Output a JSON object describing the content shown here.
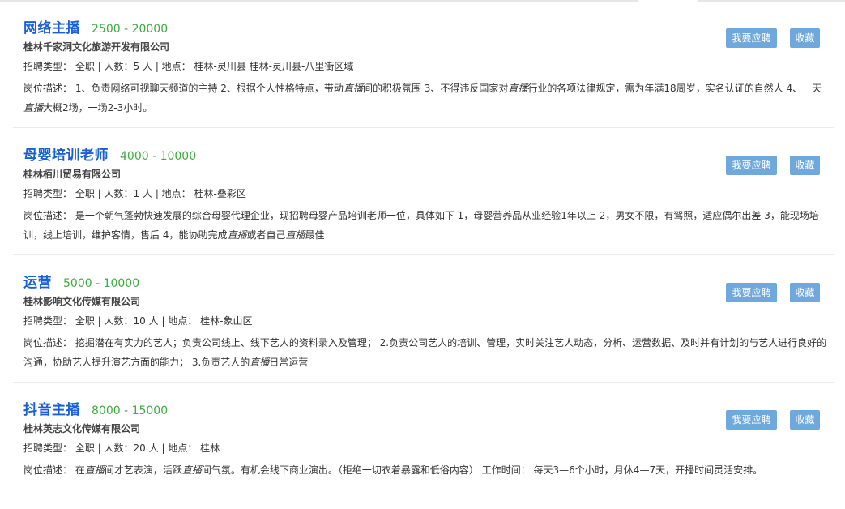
{
  "labels": {
    "type": "招聘类型：",
    "desc": "岗位描述：",
    "people": "人数：",
    "location": "地点："
  },
  "jobs": [
    {
      "title": "网络主播",
      "salary": "2500 - 20000",
      "company": "桂林千家洞文化旅游开发有限公司",
      "type": "全职",
      "count": "5 人",
      "location": "桂林-灵川县 桂林-灵川县-八里街区域",
      "desc_parts": [
        "1、负责网络可视聊天频道的主持 2、根据个人性格特点，带动",
        "直播",
        "间的积极氛围 3、不得违反国家对",
        "直播",
        "行业的各项法律规定，需为年满18周岁，实名认证的自然人 4、一天",
        "直播",
        "大概2场，一场2-3小时。"
      ],
      "apply_label": "我要应聘",
      "fav_label": "收藏"
    },
    {
      "title": "母婴培训老师",
      "salary": "4000 - 10000",
      "company": "桂林栢川贸易有限公司",
      "type": "全职",
      "count": "1 人",
      "location": "桂林-叠彩区",
      "desc_parts": [
        "是一个朝气蓬勃快速发展的综合母婴代理企业，现招聘母婴产品培训老师一位，具体如下 1，母婴营养品从业经验1年以上 2，男女不限，有驾照，适应偶尔出差 3，能现场培训，线上培训，维护客情，售后 4，能协助完成",
        "直播",
        "或者自己",
        "直播",
        "最佳"
      ],
      "apply_label": "我要应聘",
      "fav_label": "收藏"
    },
    {
      "title": "运营",
      "salary": "5000 - 10000",
      "company": "桂林影响文化传媒有限公司",
      "type": "全职",
      "count": "10 人",
      "location": "桂林-象山区",
      "desc_parts": [
        "挖掘潜在有实力的艺人；负责公司线上、线下艺人的资料录入及管理； 2.负责公司艺人的培训、管理，实时关注艺人动态，分析、运营数据、及时并有计划的与艺人进行良好的沟通，协助艺人提升演艺方面的能力； 3.负责艺人的",
        "直播",
        "日常运营"
      ],
      "apply_label": "我要应聘",
      "fav_label": "收藏"
    },
    {
      "title": "抖音主播",
      "salary": "8000 - 15000",
      "company": "桂林英志文化传媒有限公司",
      "type": "全职",
      "count": "20 人",
      "location": "桂林",
      "desc_parts": [
        "在",
        "直播",
        "间才艺表演，活跃",
        "直播",
        "间气氛。有机会线下商业演出。（拒绝一切衣着暴露和低俗内容） 工作时间： 每天3—6个小时，月休4—7天，开播时间灵活安排。"
      ],
      "apply_label": "我要应聘",
      "fav_label": "收藏"
    }
  ]
}
